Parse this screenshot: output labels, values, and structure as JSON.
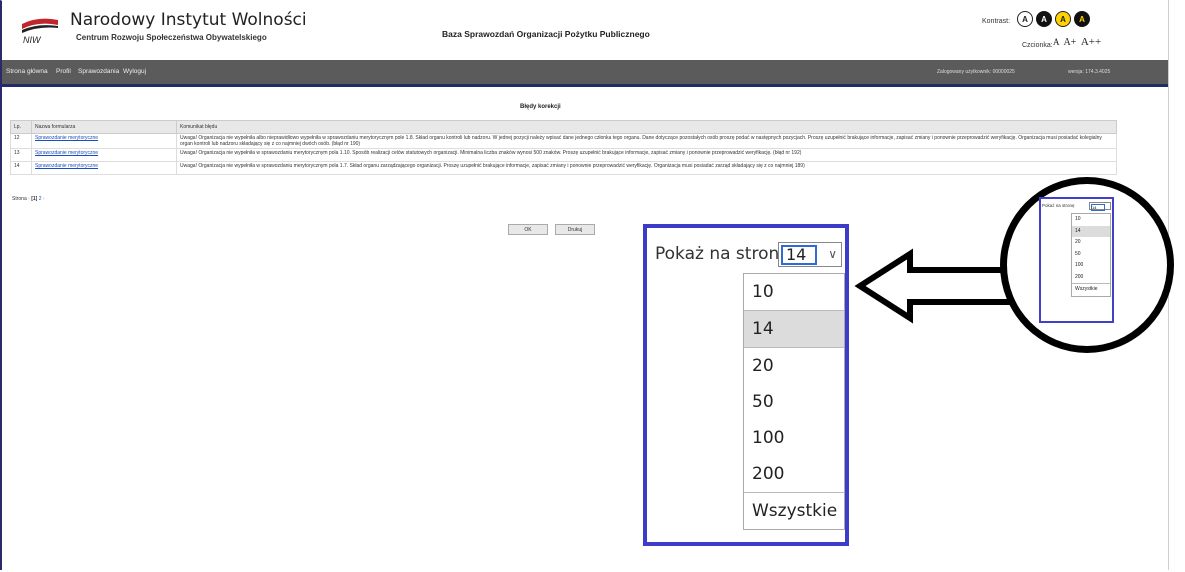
{
  "header": {
    "brand_title": "Narodowy Instytut Wolności",
    "brand_subtitle": "Centrum Rozwoju Społeczeństwa Obywatelskiego",
    "logo_text": "NIW",
    "app_title": "Baza Sprawozdań Organizacji Pożytku Publicznego",
    "contrast_label": "Kontrast:",
    "contrast_buttons": [
      "A",
      "A",
      "A",
      "A"
    ],
    "fontsize_label": "Czcionka:",
    "fontsize_buttons": [
      "A",
      "A+",
      "A++"
    ]
  },
  "nav": {
    "items": [
      "Strona główna",
      "Profil",
      "Sprawozdania",
      "Wyloguj"
    ],
    "logged_user": "Zalogowany użytkownik: 00000025",
    "version": "wersja: 174.3.4025"
  },
  "errors_table": {
    "title": "Błędy korekcji",
    "headers": [
      "Lp.",
      "Nazwa formularza",
      "Komunikat błędu"
    ],
    "rows": [
      {
        "lp": "12",
        "form": "Sprawozdanie merytoryczne",
        "message": "Uwaga! Organizacja nie wypełniła albo nieprawidłowo wypełniła w sprawozdaniu merytorycznym pole 1.8. Skład organu kontroli lub nadzoru. W jednej pozycji należy wpisać dane jednego członka tego organu. Dane dotyczące pozostałych osób proszę podać w następnych pozycjach. Proszę uzupełnić brakujące informacje, zapisać zmiany i ponownie przeprowadzić weryfikację. Organizacja musi posiadać kolegialny organ kontroli lub nadzoru składający się z co najmniej dwóch osób. (błąd nr 190)"
      },
      {
        "lp": "13",
        "form": "Sprawozdanie merytoryczne",
        "message": "Uwaga! Organizacja nie wypełniła w sprawozdaniu merytorycznym pola 1.10. Sposób realizacji celów statutowych organizacji. Minimalna liczba znaków wynosi 500 znaków. Proszę uzupełnić brakujące informacje, zapisać zmiany i ponownie przeprowadzić weryfikację. (błąd nr 192)"
      },
      {
        "lp": "14",
        "form": "Sprawozdanie merytoryczne",
        "message": "Uwaga! Organizacja nie wypełniła w sprawozdaniu merytorycznym pola 1.7. Skład organu zarządzającego organizacji. Proszę uzupełnić brakujące informacje, zapisać zmiany i ponownie przeprowadzić weryfikację. Organizacja musi posiadać zarząd składający się z co najmniej 189)"
      }
    ]
  },
  "pager": {
    "label": "Strona",
    "prev": "‹",
    "current": "[1]",
    "next_page": "2",
    "next": "›"
  },
  "buttons": {
    "ok": "OK",
    "print": "Drukuj"
  },
  "page_size": {
    "label": "Pokaż na stronę",
    "selected": "14",
    "options": [
      "10",
      "14",
      "20",
      "50",
      "100",
      "200",
      "Wszystkie"
    ],
    "mini_label": "Pokaż na stronę"
  },
  "colors": {
    "highlight_border": "#3c3cc8",
    "nav_bg": "#5b5b5b",
    "nav_border": "#1f2e6b",
    "link": "#1a4fbf",
    "accent_red": "#c0262c"
  }
}
